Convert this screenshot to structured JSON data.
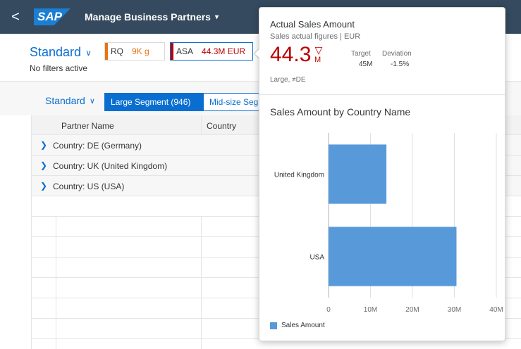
{
  "shell": {
    "back_glyph": "<",
    "logo": "SAP",
    "title": "Manage Business Partners",
    "title_caret": "▾"
  },
  "header": {
    "variant": "Standard",
    "filters_text": "No filters active",
    "kpis": [
      {
        "label": "RQ",
        "value": "9K",
        "unit": "g",
        "color": "#e9730c"
      },
      {
        "label": "ASA",
        "value": "44.3M",
        "unit": "EUR",
        "color": "#bb0000"
      }
    ]
  },
  "segments": {
    "variant": "Standard",
    "active": "Large Segment (946)",
    "other": "Mid-size Seg"
  },
  "table": {
    "columns": [
      "Partner Name",
      "Country"
    ],
    "rows": [
      "Country: DE (Germany)",
      "Country: UK (United Kingdom)",
      "Country: US (USA)"
    ]
  },
  "popover": {
    "title": "Actual Sales Amount",
    "subtitle": "Sales actual figures | EUR",
    "value": "44.3",
    "indicator": "▽",
    "scale": "M",
    "target_label": "Target",
    "target_value": "45M",
    "deviation_label": "Deviation",
    "deviation_value": "-1.5%",
    "footnote": "Large, ≠DE",
    "chart_title": "Sales Amount by Country Name",
    "legend": "Sales Amount"
  },
  "chart_data": {
    "type": "bar",
    "orientation": "horizontal",
    "title": "Sales Amount by Country Name",
    "categories": [
      "United Kingdom",
      "USA"
    ],
    "series": [
      {
        "name": "Sales Amount",
        "values": [
          13800000,
          30500000
        ]
      }
    ],
    "xlim": [
      0,
      40000000
    ],
    "xticks": [
      "0",
      "10M",
      "20M",
      "30M",
      "40M"
    ],
    "bar_color": "#5899da",
    "grid": true,
    "legend_position": "bottom-left"
  }
}
